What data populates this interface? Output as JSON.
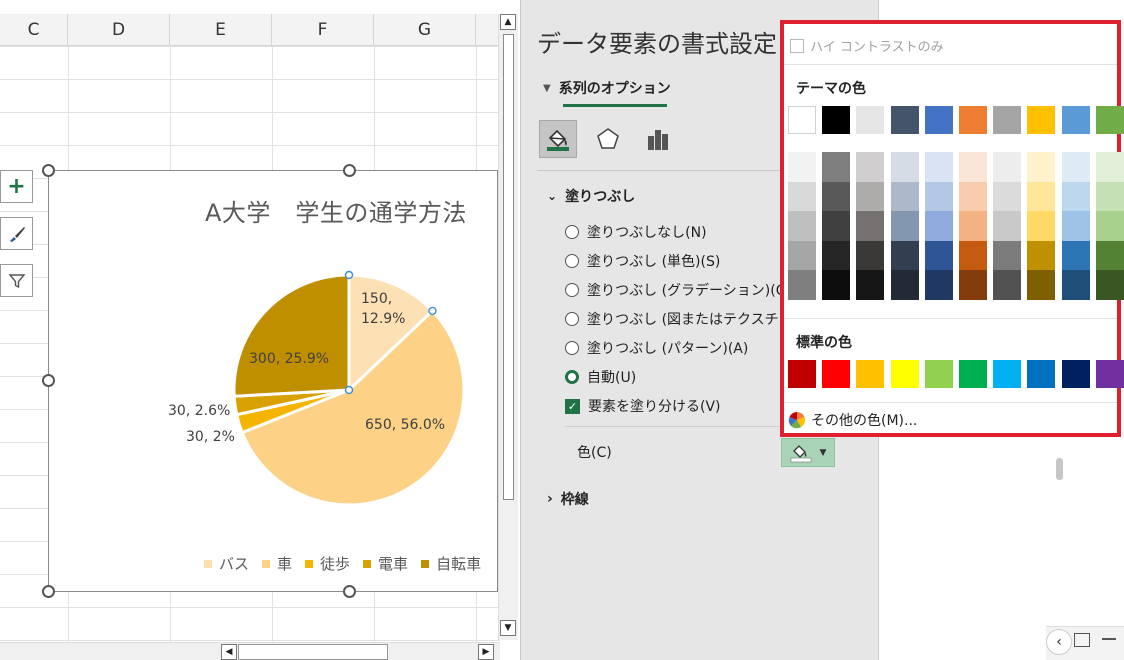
{
  "sheet": {
    "columns": [
      "C",
      "D",
      "E",
      "F",
      "G"
    ]
  },
  "chart": {
    "title": "A大学　学生の通学方法",
    "labels": {
      "bus": "150,\n12.9%",
      "bus_line1": "150,",
      "bus_line2": "12.9%",
      "car": "650, 56.0%",
      "walk": "30, 2%",
      "train": "30, 2.6%",
      "bike": "300, 25.9%"
    },
    "legend": [
      {
        "label": "バス",
        "color": "#fde0b4"
      },
      {
        "label": "車",
        "color": "#fdd287"
      },
      {
        "label": "徒歩",
        "color": "#f5b400"
      },
      {
        "label": "電車",
        "color": "#d8a000"
      },
      {
        "label": "自転車",
        "color": "#bf8f00"
      }
    ]
  },
  "chart_data": {
    "type": "pie",
    "title": "A大学　学生の通学方法",
    "categories": [
      "バス",
      "車",
      "徒歩",
      "電車",
      "自転車"
    ],
    "values": [
      150,
      650,
      30,
      30,
      300
    ],
    "percent_labels": [
      "12.9%",
      "56.0%",
      "2%",
      "2.6%",
      "25.9%"
    ],
    "colors": [
      "#fde0b4",
      "#fdd287",
      "#f5b400",
      "#d8a000",
      "#bf8f00"
    ],
    "legend_position": "bottom"
  },
  "pane": {
    "title": "データ要素の書式設定",
    "series_tab": "系列のオプション",
    "fill_section": "塗りつぶし",
    "fill_options": [
      "塗りつぶしなし(N)",
      "塗りつぶし (単色)(S)",
      "塗りつぶし (グラデーション)(G)",
      "塗りつぶし (図またはテクスチャ)(P)",
      "塗りつぶし (パターン)(A)",
      "自動(U)"
    ],
    "vary_colors": "要素を塗り分ける(V)",
    "color_label": "色(C)",
    "border_section": "枠線"
  },
  "palette": {
    "high_contrast": "ハイ コントラストのみ",
    "theme_colors_label": "テーマの色",
    "standard_colors_label": "標準の色",
    "more_colors": "その他の色(M)...",
    "theme_colors": [
      "#ffffff",
      "#000000",
      "#e7e6e6",
      "#44546a",
      "#4472c4",
      "#ed7d31",
      "#a5a5a5",
      "#ffc000",
      "#5b9bd5",
      "#70ad47"
    ],
    "theme_tints": [
      [
        "#f2f2f2",
        "#d9d9d9",
        "#bfbfbf",
        "#a6a6a6",
        "#7f7f7f"
      ],
      [
        "#7f7f7f",
        "#595959",
        "#404040",
        "#262626",
        "#0d0d0d"
      ],
      [
        "#d0cece",
        "#aeabab",
        "#757171",
        "#3b3838",
        "#171616"
      ],
      [
        "#d6dce5",
        "#adb9ca",
        "#8497b0",
        "#333f50",
        "#222a35"
      ],
      [
        "#dae3f3",
        "#b4c7e7",
        "#8faadc",
        "#2f5597",
        "#1f3864"
      ],
      [
        "#fbe5d6",
        "#f8cbad",
        "#f4b183",
        "#c55a11",
        "#843c0c"
      ],
      [
        "#ededed",
        "#dbdbdb",
        "#c9c9c9",
        "#7b7b7b",
        "#525252"
      ],
      [
        "#fff2cc",
        "#ffe699",
        "#ffd966",
        "#bf9000",
        "#7f6000"
      ],
      [
        "#deebf7",
        "#bdd7ee",
        "#9dc3e6",
        "#2e75b6",
        "#1f4e79"
      ],
      [
        "#e2f0d9",
        "#c5e0b4",
        "#a9d18e",
        "#548235",
        "#385723"
      ]
    ],
    "standard_colors": [
      "#c00000",
      "#ff0000",
      "#ffc000",
      "#ffff00",
      "#92d050",
      "#00b050",
      "#00b0f0",
      "#0070c0",
      "#002060",
      "#7030a0"
    ]
  }
}
